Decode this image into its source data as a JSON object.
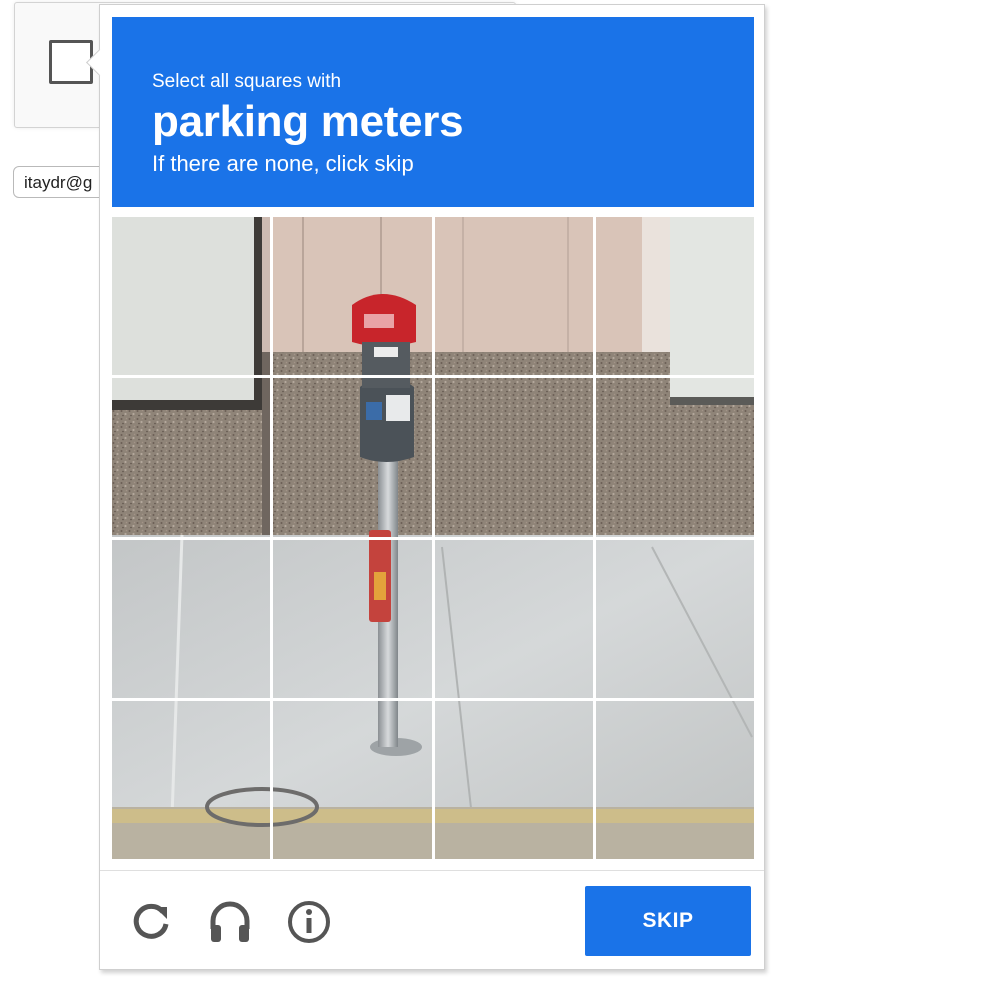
{
  "anchor": {
    "email_text": "itaydr@g"
  },
  "challenge": {
    "prompt_intro": "Select all squares with",
    "target_object": "parking meters",
    "prompt_hint": "If there are none, click skip",
    "grid": {
      "rows": 4,
      "columns": 4
    },
    "footer": {
      "reload_icon": "reload-icon",
      "audio_icon": "headphones-icon",
      "info_icon": "info-icon",
      "skip_label": "SKIP"
    },
    "colors": {
      "header_blue": "#1a73e8",
      "button_blue": "#1a73e8",
      "icon_gray": "#555555"
    }
  }
}
